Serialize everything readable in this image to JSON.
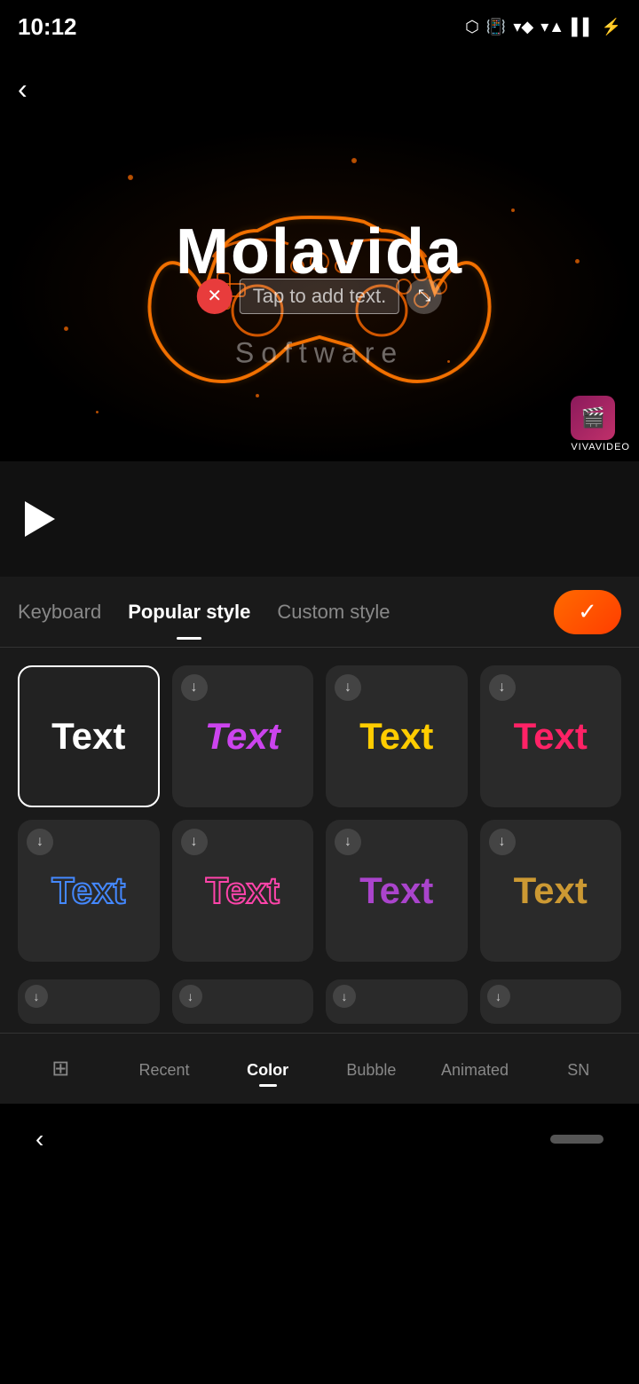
{
  "statusBar": {
    "time": "10:12",
    "icons": [
      "📋",
      "🔵",
      "📳",
      "⚡",
      "📶",
      "📶",
      "🔋"
    ]
  },
  "backButton": "‹",
  "videoPreview": {
    "title": "Molavida",
    "subtitle": "Software",
    "tapToAddText": "Tap to add text.",
    "watermark": "VIVAVIDEO"
  },
  "tabs": {
    "keyboard": "Keyboard",
    "popularStyle": "Popular style",
    "customStyle": "Custom style",
    "confirmLabel": "✓"
  },
  "styleGrid": {
    "row1": [
      {
        "id": "white",
        "label": "Text",
        "style": "white",
        "selected": true,
        "hasDownload": false
      },
      {
        "id": "purple",
        "label": "Text",
        "style": "purple",
        "selected": false,
        "hasDownload": true
      },
      {
        "id": "yellow",
        "label": "Text",
        "style": "yellow",
        "selected": false,
        "hasDownload": true
      },
      {
        "id": "pink",
        "label": "Text",
        "style": "pink",
        "selected": false,
        "hasDownload": true
      }
    ],
    "row2": [
      {
        "id": "blue-outline",
        "label": "Text",
        "style": "blue-outline",
        "selected": false,
        "hasDownload": true
      },
      {
        "id": "pink-outline",
        "label": "Text",
        "style": "pink-outline",
        "selected": false,
        "hasDownload": true
      },
      {
        "id": "purple2",
        "label": "Text",
        "style": "purple2",
        "selected": false,
        "hasDownload": true
      },
      {
        "id": "gold",
        "label": "Text",
        "style": "gold",
        "selected": false,
        "hasDownload": true
      }
    ]
  },
  "bottomNav": {
    "items": [
      {
        "id": "recent-icon",
        "label": "Recent",
        "active": false,
        "icon": "⊞"
      },
      {
        "id": "recent",
        "label": "Recent",
        "active": false
      },
      {
        "id": "color",
        "label": "Color",
        "active": true
      },
      {
        "id": "bubble",
        "label": "Bubble",
        "active": false
      },
      {
        "id": "animated",
        "label": "Animated",
        "active": false
      },
      {
        "id": "sn",
        "label": "SN",
        "active": false
      }
    ]
  }
}
